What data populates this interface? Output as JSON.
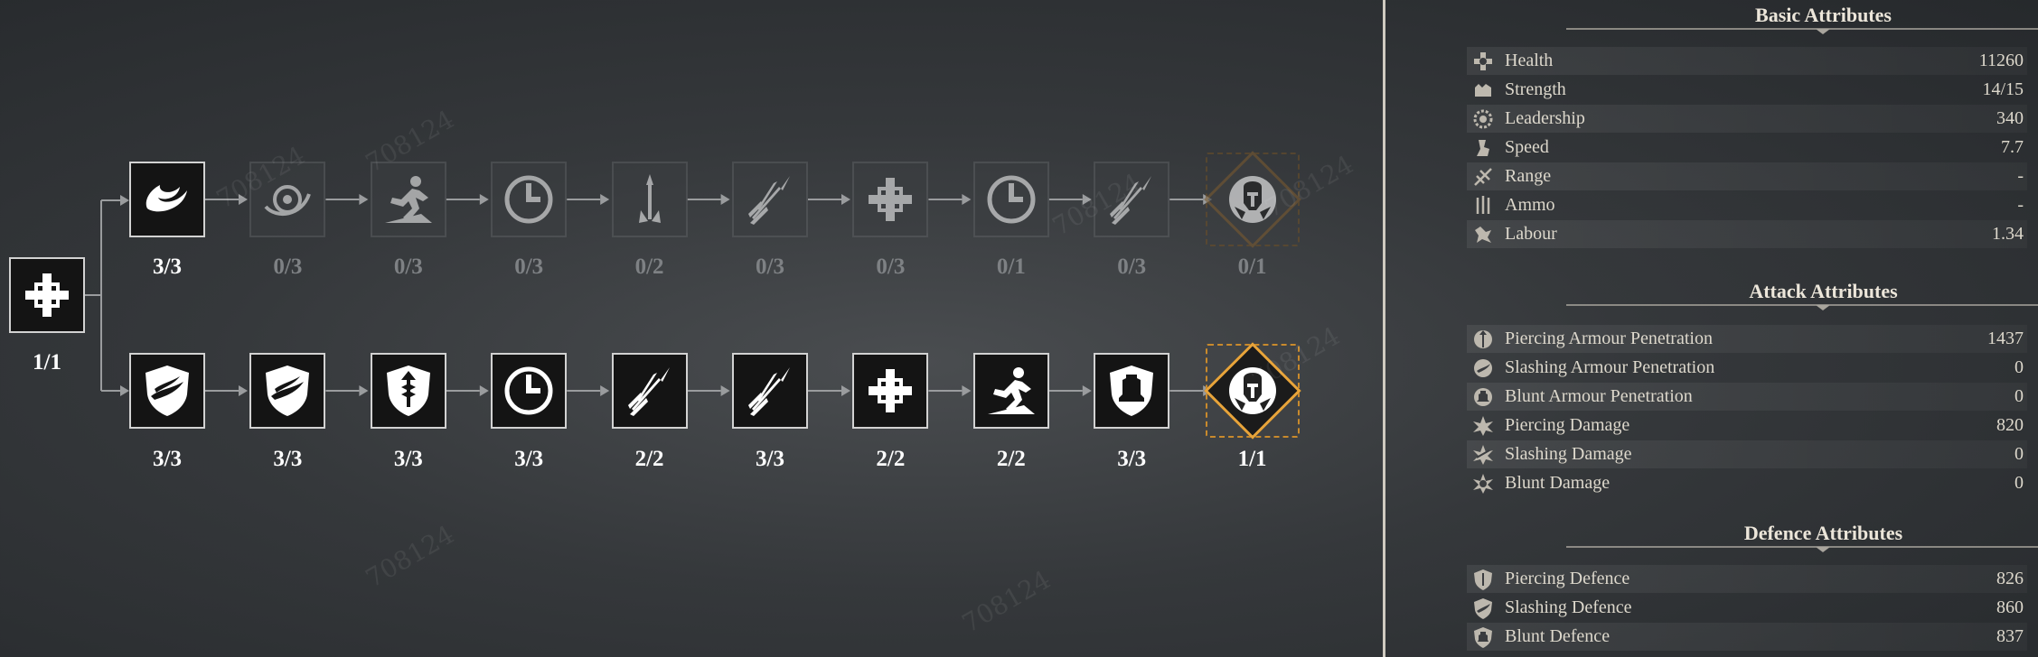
{
  "skill_tree": {
    "root": {
      "count": "1/1",
      "icon": "cross-icon"
    },
    "top_row": [
      {
        "icon": "swirl-blade-icon",
        "count": "3/3",
        "locked": false
      },
      {
        "icon": "swirl-eye-icon",
        "count": "0/3",
        "locked": true
      },
      {
        "icon": "runner-icon",
        "count": "0/3",
        "locked": true
      },
      {
        "icon": "clock-icon",
        "count": "0/3",
        "locked": true
      },
      {
        "icon": "spear-icon",
        "count": "0/2",
        "locked": true
      },
      {
        "icon": "spears-icon",
        "count": "0/3",
        "locked": true
      },
      {
        "icon": "cross-icon",
        "count": "0/3",
        "locked": true
      },
      {
        "icon": "clock-icon",
        "count": "0/1",
        "locked": true
      },
      {
        "icon": "spears-icon",
        "count": "0/3",
        "locked": true
      },
      {
        "icon": "warrior-crest-icon",
        "count": "0/1",
        "locked": true
      }
    ],
    "bottom_row": [
      {
        "icon": "shield-wing-icon",
        "count": "3/3",
        "locked": false
      },
      {
        "icon": "shield-wing-icon",
        "count": "3/3",
        "locked": false
      },
      {
        "icon": "shield-arrow-icon",
        "count": "3/3",
        "locked": false
      },
      {
        "icon": "clock-icon",
        "count": "3/3",
        "locked": false
      },
      {
        "icon": "spears-icon",
        "count": "2/2",
        "locked": false
      },
      {
        "icon": "spears-icon",
        "count": "3/3",
        "locked": false
      },
      {
        "icon": "cross-icon",
        "count": "2/2",
        "locked": false
      },
      {
        "icon": "runner-icon",
        "count": "2/2",
        "locked": false
      },
      {
        "icon": "shield-bell-icon",
        "count": "3/3",
        "locked": false
      },
      {
        "icon": "warrior-crest-icon",
        "count": "1/1",
        "locked": false
      }
    ],
    "watermark": "708124"
  },
  "attributes": {
    "basic": {
      "title": "Basic Attributes",
      "rows": [
        {
          "icon": "health-icon",
          "label": "Health",
          "value": "11260"
        },
        {
          "icon": "strength-icon",
          "label": "Strength",
          "value": "14/15"
        },
        {
          "icon": "leadership-icon",
          "label": "Leadership",
          "value": "340"
        },
        {
          "icon": "speed-icon",
          "label": "Speed",
          "value": "7.7"
        },
        {
          "icon": "range-icon",
          "label": "Range",
          "value": "-"
        },
        {
          "icon": "ammo-icon",
          "label": "Ammo",
          "value": "-"
        },
        {
          "icon": "labour-icon",
          "label": "Labour",
          "value": "1.34"
        }
      ]
    },
    "attack": {
      "title": "Attack Attributes",
      "rows": [
        {
          "icon": "piercing-pen-icon",
          "label": "Piercing Armour Penetration",
          "value": "1437"
        },
        {
          "icon": "slashing-pen-icon",
          "label": "Slashing Armour Penetration",
          "value": "0"
        },
        {
          "icon": "blunt-pen-icon",
          "label": "Blunt Armour Penetration",
          "value": "0"
        },
        {
          "icon": "piercing-damage-icon",
          "label": "Piercing Damage",
          "value": "820"
        },
        {
          "icon": "slashing-damage-icon",
          "label": "Slashing Damage",
          "value": "0"
        },
        {
          "icon": "blunt-damage-icon",
          "label": "Blunt Damage",
          "value": "0"
        }
      ]
    },
    "defence": {
      "title": "Defence Attributes",
      "rows": [
        {
          "icon": "piercing-defence-icon",
          "label": "Piercing Defence",
          "value": "826"
        },
        {
          "icon": "slashing-defence-icon",
          "label": "Slashing Defence",
          "value": "860"
        },
        {
          "icon": "blunt-defence-icon",
          "label": "Blunt Defence",
          "value": "837"
        }
      ]
    }
  }
}
